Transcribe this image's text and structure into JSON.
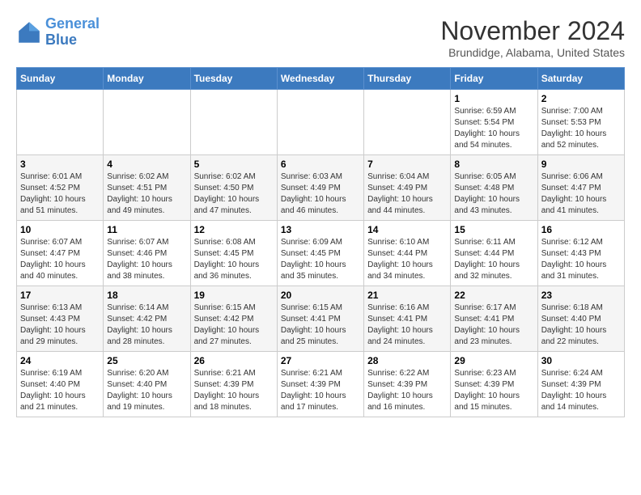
{
  "header": {
    "logo_line1": "General",
    "logo_line2": "Blue",
    "month": "November 2024",
    "location": "Brundidge, Alabama, United States"
  },
  "weekdays": [
    "Sunday",
    "Monday",
    "Tuesday",
    "Wednesday",
    "Thursday",
    "Friday",
    "Saturday"
  ],
  "weeks": [
    [
      {
        "day": "",
        "info": ""
      },
      {
        "day": "",
        "info": ""
      },
      {
        "day": "",
        "info": ""
      },
      {
        "day": "",
        "info": ""
      },
      {
        "day": "",
        "info": ""
      },
      {
        "day": "1",
        "info": "Sunrise: 6:59 AM\nSunset: 5:54 PM\nDaylight: 10 hours\nand 54 minutes."
      },
      {
        "day": "2",
        "info": "Sunrise: 7:00 AM\nSunset: 5:53 PM\nDaylight: 10 hours\nand 52 minutes."
      }
    ],
    [
      {
        "day": "3",
        "info": "Sunrise: 6:01 AM\nSunset: 4:52 PM\nDaylight: 10 hours\nand 51 minutes."
      },
      {
        "day": "4",
        "info": "Sunrise: 6:02 AM\nSunset: 4:51 PM\nDaylight: 10 hours\nand 49 minutes."
      },
      {
        "day": "5",
        "info": "Sunrise: 6:02 AM\nSunset: 4:50 PM\nDaylight: 10 hours\nand 47 minutes."
      },
      {
        "day": "6",
        "info": "Sunrise: 6:03 AM\nSunset: 4:49 PM\nDaylight: 10 hours\nand 46 minutes."
      },
      {
        "day": "7",
        "info": "Sunrise: 6:04 AM\nSunset: 4:49 PM\nDaylight: 10 hours\nand 44 minutes."
      },
      {
        "day": "8",
        "info": "Sunrise: 6:05 AM\nSunset: 4:48 PM\nDaylight: 10 hours\nand 43 minutes."
      },
      {
        "day": "9",
        "info": "Sunrise: 6:06 AM\nSunset: 4:47 PM\nDaylight: 10 hours\nand 41 minutes."
      }
    ],
    [
      {
        "day": "10",
        "info": "Sunrise: 6:07 AM\nSunset: 4:47 PM\nDaylight: 10 hours\nand 40 minutes."
      },
      {
        "day": "11",
        "info": "Sunrise: 6:07 AM\nSunset: 4:46 PM\nDaylight: 10 hours\nand 38 minutes."
      },
      {
        "day": "12",
        "info": "Sunrise: 6:08 AM\nSunset: 4:45 PM\nDaylight: 10 hours\nand 36 minutes."
      },
      {
        "day": "13",
        "info": "Sunrise: 6:09 AM\nSunset: 4:45 PM\nDaylight: 10 hours\nand 35 minutes."
      },
      {
        "day": "14",
        "info": "Sunrise: 6:10 AM\nSunset: 4:44 PM\nDaylight: 10 hours\nand 34 minutes."
      },
      {
        "day": "15",
        "info": "Sunrise: 6:11 AM\nSunset: 4:44 PM\nDaylight: 10 hours\nand 32 minutes."
      },
      {
        "day": "16",
        "info": "Sunrise: 6:12 AM\nSunset: 4:43 PM\nDaylight: 10 hours\nand 31 minutes."
      }
    ],
    [
      {
        "day": "17",
        "info": "Sunrise: 6:13 AM\nSunset: 4:43 PM\nDaylight: 10 hours\nand 29 minutes."
      },
      {
        "day": "18",
        "info": "Sunrise: 6:14 AM\nSunset: 4:42 PM\nDaylight: 10 hours\nand 28 minutes."
      },
      {
        "day": "19",
        "info": "Sunrise: 6:15 AM\nSunset: 4:42 PM\nDaylight: 10 hours\nand 27 minutes."
      },
      {
        "day": "20",
        "info": "Sunrise: 6:15 AM\nSunset: 4:41 PM\nDaylight: 10 hours\nand 25 minutes."
      },
      {
        "day": "21",
        "info": "Sunrise: 6:16 AM\nSunset: 4:41 PM\nDaylight: 10 hours\nand 24 minutes."
      },
      {
        "day": "22",
        "info": "Sunrise: 6:17 AM\nSunset: 4:41 PM\nDaylight: 10 hours\nand 23 minutes."
      },
      {
        "day": "23",
        "info": "Sunrise: 6:18 AM\nSunset: 4:40 PM\nDaylight: 10 hours\nand 22 minutes."
      }
    ],
    [
      {
        "day": "24",
        "info": "Sunrise: 6:19 AM\nSunset: 4:40 PM\nDaylight: 10 hours\nand 21 minutes."
      },
      {
        "day": "25",
        "info": "Sunrise: 6:20 AM\nSunset: 4:40 PM\nDaylight: 10 hours\nand 19 minutes."
      },
      {
        "day": "26",
        "info": "Sunrise: 6:21 AM\nSunset: 4:39 PM\nDaylight: 10 hours\nand 18 minutes."
      },
      {
        "day": "27",
        "info": "Sunrise: 6:21 AM\nSunset: 4:39 PM\nDaylight: 10 hours\nand 17 minutes."
      },
      {
        "day": "28",
        "info": "Sunrise: 6:22 AM\nSunset: 4:39 PM\nDaylight: 10 hours\nand 16 minutes."
      },
      {
        "day": "29",
        "info": "Sunrise: 6:23 AM\nSunset: 4:39 PM\nDaylight: 10 hours\nand 15 minutes."
      },
      {
        "day": "30",
        "info": "Sunrise: 6:24 AM\nSunset: 4:39 PM\nDaylight: 10 hours\nand 14 minutes."
      }
    ]
  ]
}
